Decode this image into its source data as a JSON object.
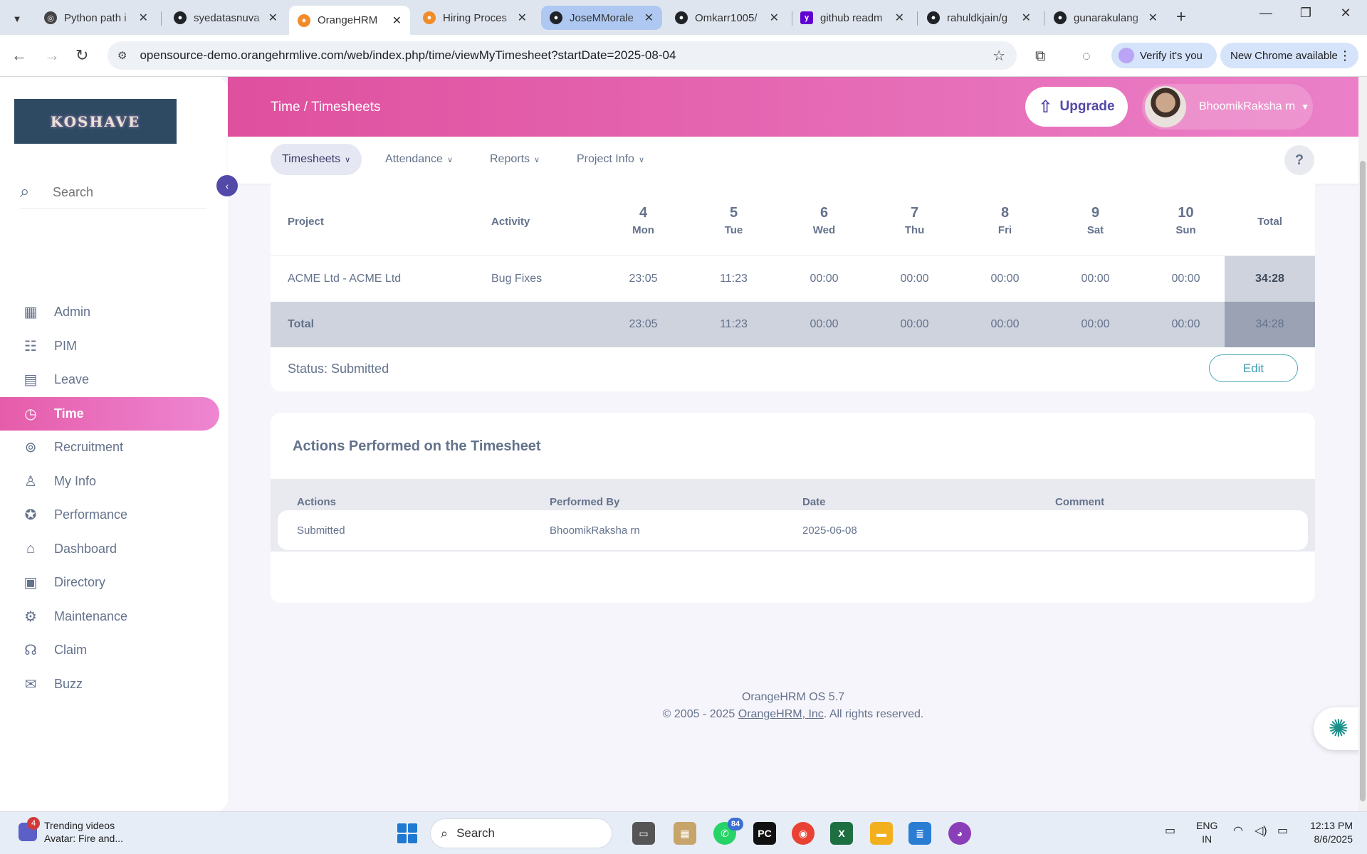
{
  "browser": {
    "tabs": [
      {
        "title": "Python path i",
        "favicon_color": "#444444"
      },
      {
        "title": "syedatasnuva",
        "favicon_color": "#1f2328"
      },
      {
        "title": "OrangeHRM",
        "favicon_color": "#f28c28"
      },
      {
        "title": "Hiring Proces",
        "favicon_color": "#f28c28"
      },
      {
        "title": "JoseMMorale",
        "favicon_color": "#1f2328"
      },
      {
        "title": "Omkarr1005/",
        "favicon_color": "#1f2328"
      },
      {
        "title": "github readm",
        "favicon_color": "#6001d2"
      },
      {
        "title": "rahuldkjain/g",
        "favicon_color": "#1f2328"
      },
      {
        "title": "gunarakulang",
        "favicon_color": "#1f2328"
      }
    ],
    "url": "opensource-demo.orangehrmlive.com/web/index.php/time/viewMyTimesheet?startDate=2025-08-04",
    "verify_label": "Verify it's you",
    "update_label": "New Chrome available"
  },
  "app": {
    "brand_text": "KOSHAVE",
    "breadcrumb": "Time / Timesheets",
    "upgrade_label": "Upgrade",
    "user_name": "BhoomikRaksha rn",
    "accent_color": "#e55caa",
    "secondary_color": "#5249a8"
  },
  "sidebar": {
    "search_placeholder": "Search",
    "items": [
      {
        "label": "Admin",
        "icon": "admin-icon"
      },
      {
        "label": "PIM",
        "icon": "pim-icon"
      },
      {
        "label": "Leave",
        "icon": "leave-icon"
      },
      {
        "label": "Time",
        "icon": "time-icon",
        "active": true
      },
      {
        "label": "Recruitment",
        "icon": "recruitment-icon"
      },
      {
        "label": "My Info",
        "icon": "my-info-icon"
      },
      {
        "label": "Performance",
        "icon": "performance-icon"
      },
      {
        "label": "Dashboard",
        "icon": "dashboard-icon"
      },
      {
        "label": "Directory",
        "icon": "directory-icon"
      },
      {
        "label": "Maintenance",
        "icon": "maintenance-icon"
      },
      {
        "label": "Claim",
        "icon": "claim-icon"
      },
      {
        "label": "Buzz",
        "icon": "buzz-icon"
      }
    ]
  },
  "subnav": {
    "items": [
      "Timesheets",
      "Attendance",
      "Reports",
      "Project Info"
    ],
    "help_label": "?"
  },
  "timesheet": {
    "headers": {
      "project": "Project",
      "activity": "Activity",
      "total": "Total"
    },
    "days": [
      {
        "num": "4",
        "name": "Mon"
      },
      {
        "num": "5",
        "name": "Tue"
      },
      {
        "num": "6",
        "name": "Wed"
      },
      {
        "num": "7",
        "name": "Thu"
      },
      {
        "num": "8",
        "name": "Fri"
      },
      {
        "num": "9",
        "name": "Sat"
      },
      {
        "num": "10",
        "name": "Sun"
      }
    ],
    "rows": [
      {
        "project": "ACME Ltd - ACME Ltd",
        "activity": "Bug Fixes",
        "hours": [
          "23:05",
          "11:23",
          "00:00",
          "00:00",
          "00:00",
          "00:00",
          "00:00"
        ],
        "total": "34:28"
      }
    ],
    "total_row": {
      "label": "Total",
      "hours": [
        "23:05",
        "11:23",
        "00:00",
        "00:00",
        "00:00",
        "00:00",
        "00:00"
      ],
      "total": "34:28"
    },
    "status": "Status: Submitted",
    "edit_label": "Edit"
  },
  "actions": {
    "title": "Actions Performed on the Timesheet",
    "headers": [
      "Actions",
      "Performed By",
      "Date",
      "Comment"
    ],
    "rows": [
      {
        "action": "Submitted",
        "performed_by": "BhoomikRaksha rn",
        "date": "2025-06-08",
        "comment": ""
      }
    ]
  },
  "footer": {
    "version": "OrangeHRM OS 5.7",
    "copyright_prefix": "© 2005 - 2025 ",
    "company_link": "OrangeHRM, Inc",
    "copyright_suffix": ". All rights reserved."
  },
  "taskbar": {
    "widget_badge": "4",
    "widget_title": "Trending videos",
    "widget_subtitle": "Avatar: Fire and...",
    "search_label": "Search",
    "whatsapp_badge": "84",
    "lang_line1": "ENG",
    "lang_line2": "IN",
    "time": "12:13 PM",
    "date": "8/6/2025"
  }
}
